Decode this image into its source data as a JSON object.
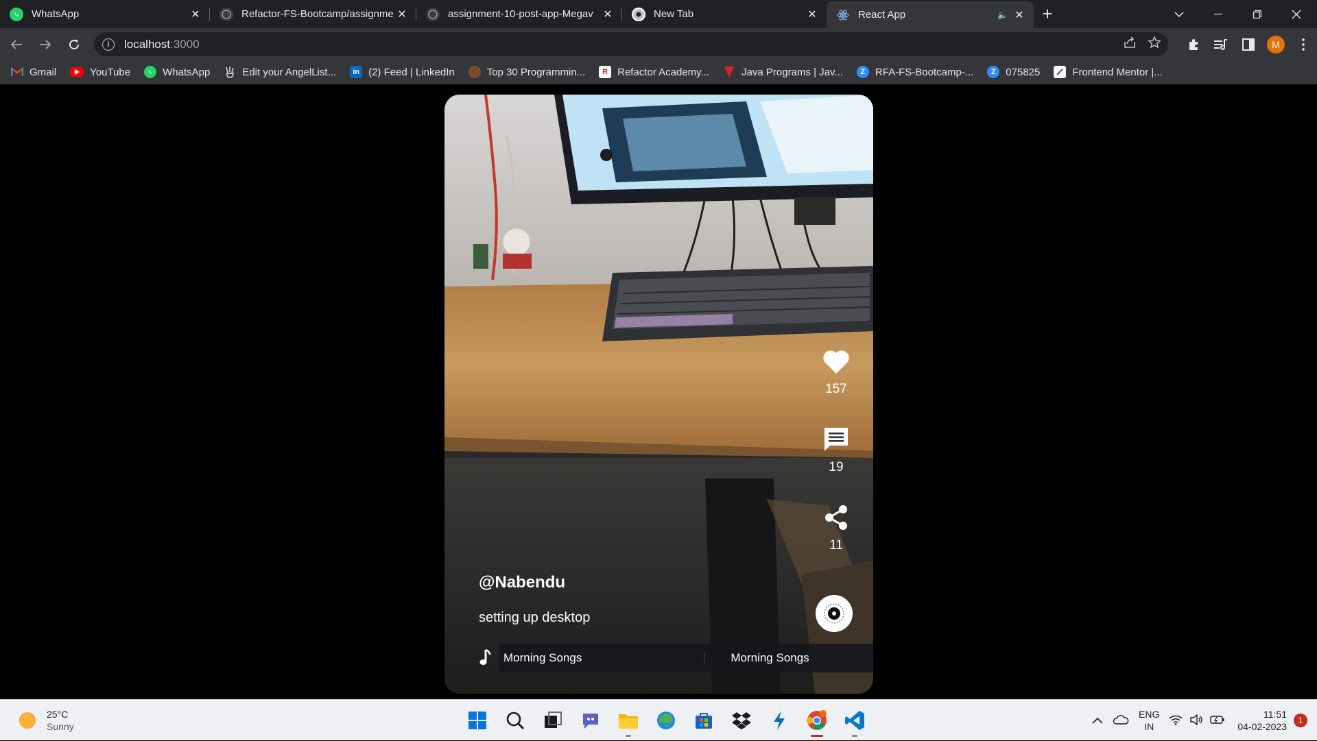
{
  "browser": {
    "tabs": [
      {
        "title": "WhatsApp",
        "favicon": "whatsapp-icon",
        "active": false
      },
      {
        "title": "Refactor-FS-Bootcamp/assignme",
        "favicon": "github-icon",
        "active": false
      },
      {
        "title": "assignment-10-post-app-Megav",
        "favicon": "github-icon",
        "active": false
      },
      {
        "title": "New Tab",
        "favicon": "chrome-icon",
        "active": false
      },
      {
        "title": "React App",
        "favicon": "react-icon",
        "active": true,
        "muted": true
      }
    ],
    "url_host": "localhost",
    "url_port": ":3000",
    "profile_initial": "M"
  },
  "bookmarks": [
    {
      "label": "Gmail",
      "icon": "gmail-icon"
    },
    {
      "label": "YouTube",
      "icon": "youtube-icon"
    },
    {
      "label": "WhatsApp",
      "icon": "whatsapp-icon"
    },
    {
      "label": "Edit your AngelList...",
      "icon": "angellist-icon"
    },
    {
      "label": "(2) Feed | LinkedIn",
      "icon": "linkedin-icon"
    },
    {
      "label": "Top 30 Programmin...",
      "icon": "bookmark-site-icon"
    },
    {
      "label": "Refactor Academy...",
      "icon": "refactor-icon"
    },
    {
      "label": "Java Programs | Jav...",
      "icon": "javatpoint-icon"
    },
    {
      "label": "RFA-FS-Bootcamp-...",
      "icon": "zoom-icon"
    },
    {
      "label": "075825",
      "icon": "zoom-icon"
    },
    {
      "label": "Frontend Mentor |...",
      "icon": "frontend-mentor-icon"
    }
  ],
  "video": {
    "likes": "157",
    "comments": "19",
    "shares": "11",
    "username": "@Nabendu",
    "description": "setting up desktop",
    "song_1": "Morning Songs",
    "song_2": "Morning Songs"
  },
  "taskbar": {
    "temperature": "25°C",
    "condition": "Sunny",
    "lang_top": "ENG",
    "lang_bottom": "IN",
    "time": "11:51",
    "date": "04-02-2023",
    "notifications": "1"
  },
  "colors": {
    "tab_bg": "#202124",
    "toolbar_bg": "#35363a",
    "profile": "#e8710a",
    "taskbar_bg": "#eef0f4"
  }
}
